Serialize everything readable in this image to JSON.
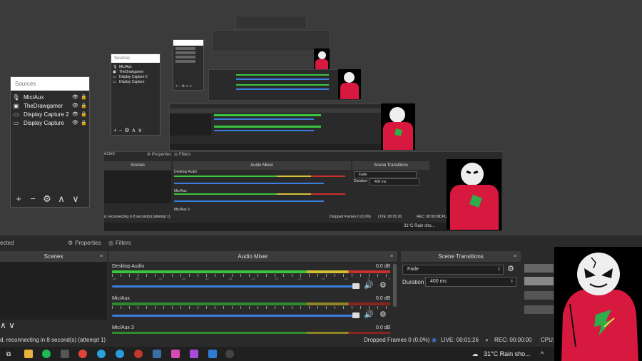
{
  "sources_panel": {
    "title": "Sources",
    "items": [
      {
        "label": "Mic/Aux",
        "icon": "microphone-icon"
      },
      {
        "label": "TheDrawgamer",
        "icon": "window-capture-icon"
      },
      {
        "label": "Display Capture 2",
        "icon": "monitor-icon"
      },
      {
        "label": "Display Capture",
        "icon": "monitor-icon"
      }
    ]
  },
  "sources_small": {
    "title": "Sources",
    "items": [
      "Mic/Aux",
      "TheDrawgamer",
      "Display Capture 2",
      "Display Capture"
    ]
  },
  "dock": {
    "cut_label": "ected",
    "properties_label": "Properties",
    "filters_label": "Filters"
  },
  "scenes": {
    "title": "Scenes"
  },
  "audio_mixer": {
    "title": "Audio Mixer",
    "channels": [
      {
        "name": "Desktop Audio",
        "db": "0.0 dB"
      },
      {
        "name": "Mic/Aux",
        "db": "0.0 dB"
      },
      {
        "name": "Mic/Aux 3",
        "db": "0.0 dB"
      }
    ],
    "tick_labels": [
      "-60",
      "-55",
      "-50",
      "-45",
      "-40",
      "-35",
      "-30",
      "-25",
      "-20",
      "-15",
      "-10",
      "-5",
      "0"
    ]
  },
  "scene_transitions": {
    "title": "Scene Transitions",
    "transition": "Fade",
    "duration_label": "Duration",
    "duration_value": "400 ms"
  },
  "mid_window": {
    "scenes_title": "Scenes",
    "mixer_title": "Audio Mixer",
    "transitions_title": "Scene Transitions",
    "desktop_audio": "Desktop Audio",
    "mic_aux": "Mic/Aux",
    "mic_aux3": "Mic/Aux 3",
    "transition": "Fade",
    "duration_label": "Duration",
    "duration_value": "400 ms",
    "status_left": "d, reconnecting in 8 second(s) (attempt 1)",
    "dropped": "Dropped Frames 0 (0.0%)",
    "live": "LIVE: 00:01:26",
    "rec": "REC: 00:00:00",
    "cpu": "CPU",
    "weather": "31°C Rain sho...",
    "properties": "Properties",
    "filters": "Filters",
    "cut": "ected"
  },
  "status": {
    "reconnect": "d, reconnecting in 8 second(s) (attempt 1)",
    "dropped_frames": "Dropped Frames 0 (0.0%)",
    "live": "LIVE: 00:01:26",
    "rec": "REC: 00:00:00",
    "cpu": "CPU:"
  },
  "taskbar": {
    "weather": "31°C  Rain sho...",
    "apps": [
      "task-view-icon",
      "file-explorer-icon",
      "spotify-icon",
      "calculator-icon",
      "chrome-icon",
      "telegram-icon",
      "edge-icon",
      "screen-recorder-icon",
      "app-icon",
      "paint-icon",
      "heart-app-icon",
      "photos-icon",
      "obs-icon"
    ]
  },
  "colors": {
    "meter_green": "#3cc43c",
    "meter_yellow": "#d2c234",
    "meter_red": "#c8302c",
    "volume_blue": "#3c7ee0",
    "character_red": "#d7183f"
  }
}
